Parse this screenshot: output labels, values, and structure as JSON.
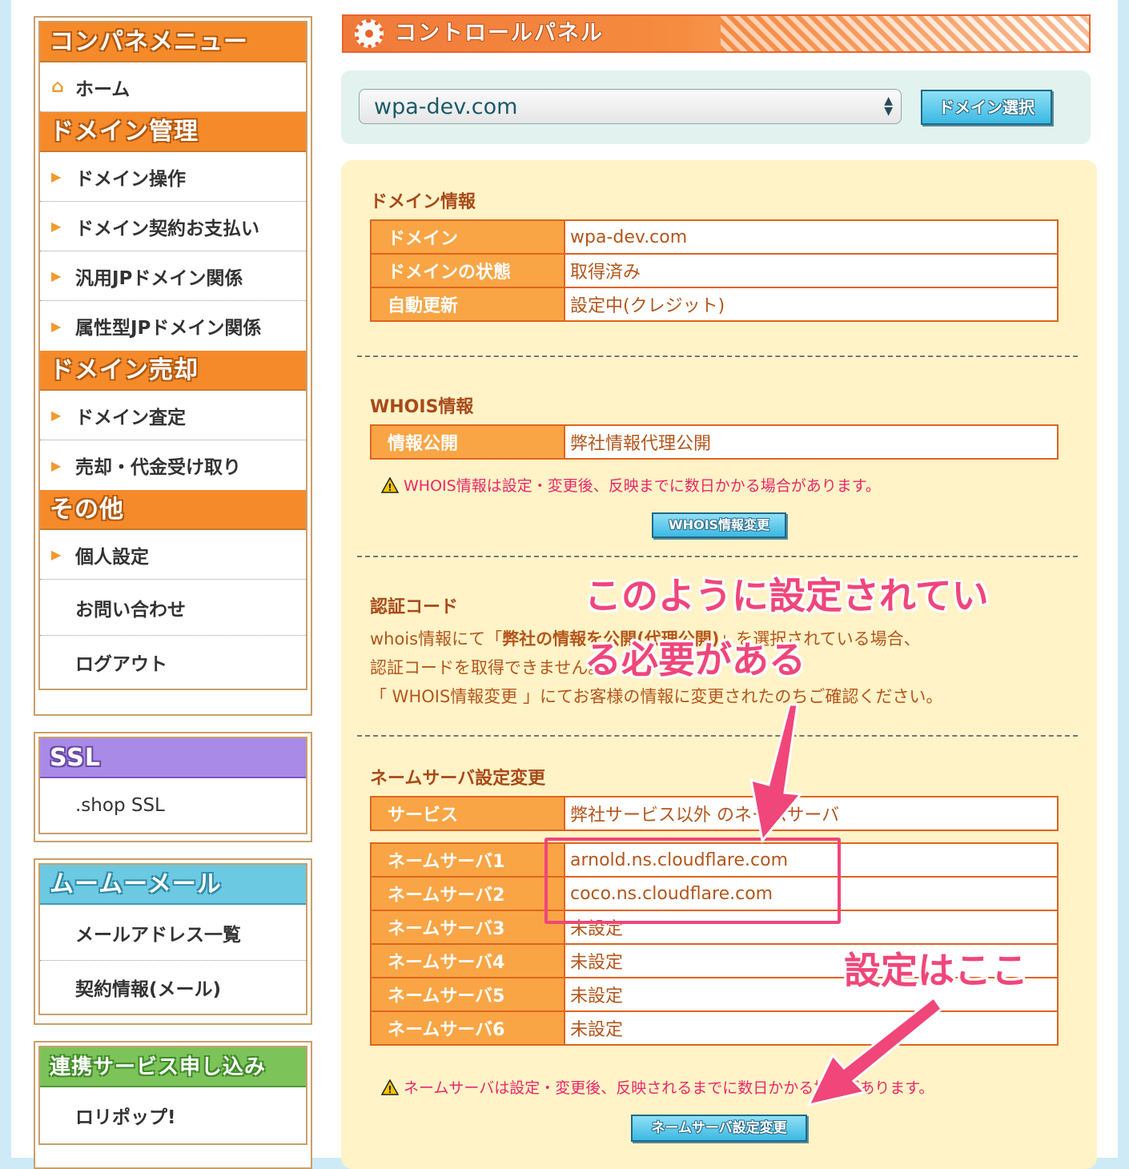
{
  "sidebar": {
    "menu_title": "コンパネメニュー",
    "home": "ホーム",
    "sections": [
      {
        "title": "ドメイン管理",
        "items": [
          "ドメイン操作",
          "ドメイン契約お支払い",
          "汎用JPドメイン関係",
          "属性型JPドメイン関係"
        ]
      },
      {
        "title": "ドメイン売却",
        "items": [
          "ドメイン査定",
          "売却・代金受け取り"
        ]
      },
      {
        "title": "その他",
        "items": [
          "個人設定",
          "お問い合わせ",
          "ログアウト"
        ]
      }
    ],
    "ssl": {
      "title": "SSL",
      "items": [
        ".shop SSL"
      ]
    },
    "mail": {
      "title": "ムームーメール",
      "items": [
        "メールアドレス一覧",
        "契約情報(メール)"
      ]
    },
    "linked": {
      "title": "連携サービス申し込み",
      "items": [
        "ロリポップ!"
      ]
    }
  },
  "header": {
    "title": "コントロールパネル"
  },
  "domain_select": {
    "value": "wpa-dev.com",
    "button": "ドメイン選択"
  },
  "domain_info": {
    "title": "ドメイン情報",
    "rows": [
      {
        "key": "ドメイン",
        "value": "wpa-dev.com"
      },
      {
        "key": "ドメインの状態",
        "value": "取得済み"
      },
      {
        "key": "自動更新",
        "value": "設定中(クレジット)"
      }
    ]
  },
  "whois": {
    "title": "WHOIS情報",
    "rows": [
      {
        "key": "情報公開",
        "value": "弊社情報代理公開"
      }
    ],
    "warning": "WHOIS情報は設定・変更後、反映までに数日かかる場合があります。",
    "button": "WHOIS情報変更"
  },
  "auth_code": {
    "title": "認証コード",
    "line1_a": "whois情報にて「",
    "line1_b": "弊社の情報を公開(代理公開)",
    "line1_c": "」を選択されている場合、",
    "line2": "認証コードを取得できません。",
    "line3": "「 WHOIS情報変更 」にてお客様の情報に変更されたのちご確認ください。"
  },
  "nameserver": {
    "title": "ネームサーバ設定変更",
    "service": {
      "key": "サービス",
      "value": "弊社サービス以外 のネームサーバ"
    },
    "rows": [
      {
        "key": "ネームサーバ1",
        "value": "arnold.ns.cloudflare.com"
      },
      {
        "key": "ネームサーバ2",
        "value": "coco.ns.cloudflare.com"
      },
      {
        "key": "ネームサーバ3",
        "value": "未設定"
      },
      {
        "key": "ネームサーバ4",
        "value": "未設定"
      },
      {
        "key": "ネームサーバ5",
        "value": "未設定"
      },
      {
        "key": "ネームサーバ6",
        "value": "未設定"
      }
    ],
    "warning": "ネームサーバは設定・変更後、反映されるまでに数日かかる場合があります。",
    "button": "ネームサーバ設定変更"
  },
  "annotations": {
    "note1_line1": "このように設定されてい",
    "note1_line2": "る必要がある",
    "note2": "設定はここ",
    "color": "#f0467a"
  }
}
